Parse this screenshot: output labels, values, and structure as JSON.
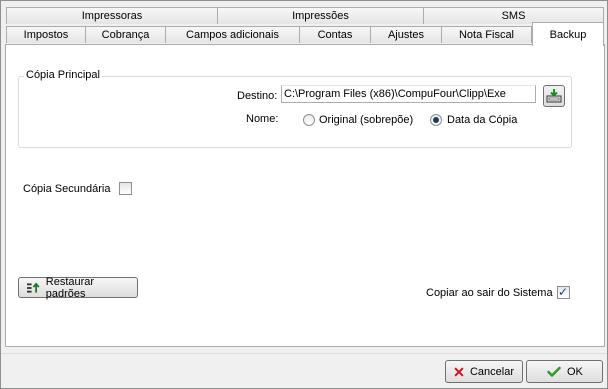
{
  "tabs": {
    "row1": [
      {
        "label": "Impressoras"
      },
      {
        "label": "Impressões"
      },
      {
        "label": "SMS"
      }
    ],
    "row2": [
      {
        "label": "Impostos"
      },
      {
        "label": "Cobrança"
      },
      {
        "label": "Campos adicionais"
      },
      {
        "label": "Contas"
      },
      {
        "label": "Ajustes"
      },
      {
        "label": "Nota Fiscal"
      }
    ],
    "active": "Backup"
  },
  "backup": {
    "primary_group": "Cópia Principal",
    "destination_label": "Destino:",
    "destination_value": "C:\\Program Files (x86)\\CompuFour\\Clipp\\Exe",
    "name_label": "Nome:",
    "options": [
      {
        "label": "Original (sobrepõe)",
        "checked": false
      },
      {
        "label": "Data da Cópia",
        "checked": true
      }
    ],
    "secondary_label": "Cópia Secundária",
    "secondary_checked": false,
    "restore_button": "Restaurar padrões",
    "copy_on_exit_label": "Copiar ao sair do Sistema",
    "copy_on_exit_checked": true
  },
  "footer": {
    "cancel": "Cancelar",
    "ok": "OK"
  },
  "colors": {
    "cancel_icon": "#d0161c",
    "ok_icon": "#2e9c2a",
    "restore_icon": "#1a7a2a"
  }
}
